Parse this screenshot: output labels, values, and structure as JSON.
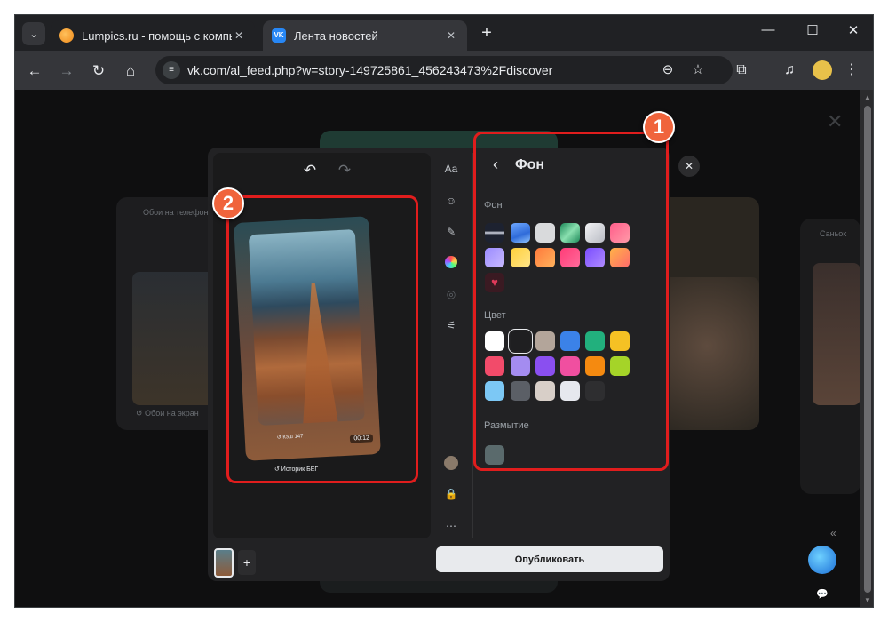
{
  "browser": {
    "tabs": [
      {
        "label": "Lumpics.ru - помощь с компью",
        "favicon": "orange-circle-icon",
        "active": false
      },
      {
        "label": "Лента новостей",
        "favicon": "vk-icon",
        "active": true
      }
    ],
    "new_tab": "+",
    "window_controls": {
      "minimize": "—",
      "maximize": "☐",
      "close": "✕"
    },
    "address": "vk.com/al_feed.php?w=story-149725861_456243473%2Fdiscover"
  },
  "editor": {
    "story_caption_inner": "↺ Кэш 147",
    "story_duration": "00:12",
    "story_caption_outer": "↺ Историк БЕГ",
    "panel": {
      "title": "Фон",
      "sections": {
        "background": "Фон",
        "color": "Цвет",
        "blur": "Размытие"
      }
    },
    "publish_label": "Опубликовать",
    "add_page": "+"
  },
  "callouts": [
    {
      "number": "1"
    },
    {
      "number": "2"
    }
  ],
  "background_cards": {
    "left_top_label": "Обои на телефон",
    "left_bottom_label": "↺ Обои на экран",
    "right_top_label": "Саньок"
  },
  "colors": {
    "accent_red": "#e01d1d",
    "badge": "#f0643c"
  }
}
